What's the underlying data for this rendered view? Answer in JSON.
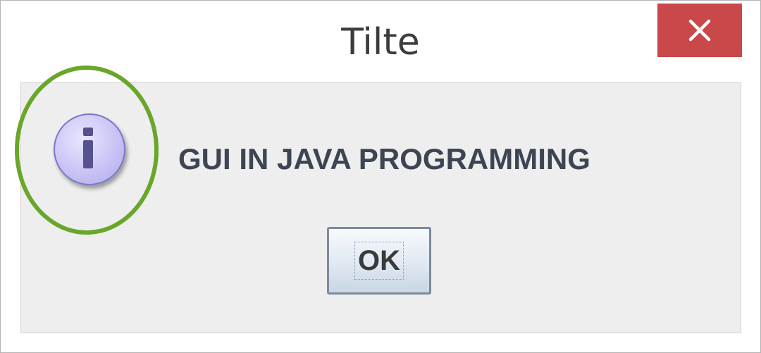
{
  "window": {
    "title": "Tilte",
    "close_icon": "close-icon"
  },
  "dialog": {
    "icon": "information-icon",
    "message": "GUI IN JAVA PROGRAMMING",
    "ok_label": "OK"
  },
  "colors": {
    "close_button": "#c9484a",
    "highlight_ring": "#6aa62a",
    "content_background": "#eeeeee"
  }
}
